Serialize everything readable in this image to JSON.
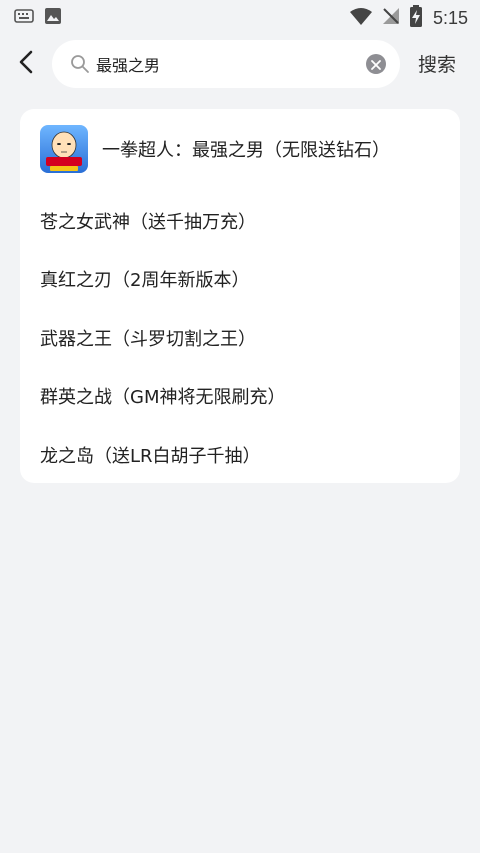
{
  "status_bar": {
    "time": "5:15",
    "left_icons": [
      "keyboard-icon",
      "image-icon"
    ],
    "right_icons": [
      "wifi-icon",
      "no-signal-icon",
      "battery-charging-icon"
    ]
  },
  "search": {
    "query": "最强之男",
    "submit_label": "搜索"
  },
  "results": {
    "top_result": {
      "title": "一拳超人：最强之男（无限送钻石）",
      "icon": "one-punch-man-game-icon"
    },
    "items": [
      {
        "title": "苍之女武神（送千抽万充）"
      },
      {
        "title": "真红之刃（2周年新版本）"
      },
      {
        "title": "武器之王（斗罗切割之王）"
      },
      {
        "title": "群英之战（GM神将无限刷充）"
      },
      {
        "title": "龙之岛（送LR白胡子千抽）"
      }
    ]
  },
  "colors": {
    "page_background": "#f2f3f5",
    "card_background": "#ffffff",
    "text_primary": "#222222",
    "icon_gray": "#8e8e93"
  }
}
